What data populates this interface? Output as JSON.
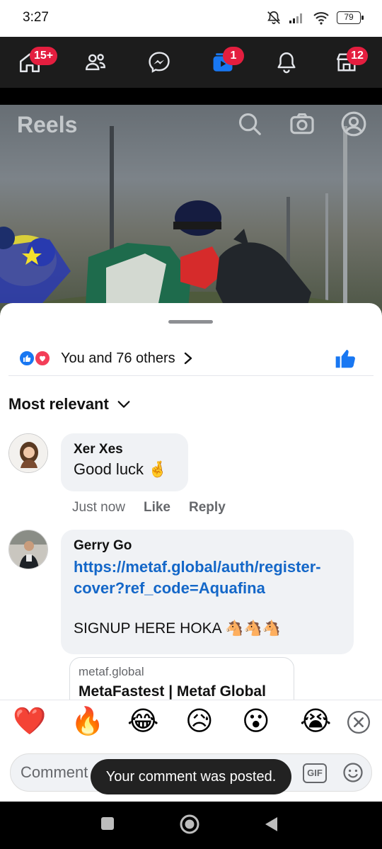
{
  "status": {
    "time": "3:27",
    "battery": "79"
  },
  "nav": {
    "home_badge": "15+",
    "watch_badge": "1",
    "marketplace_badge": "12"
  },
  "reels": {
    "title": "Reels"
  },
  "reactions": {
    "summary": "You and 76 others"
  },
  "sort": {
    "label": "Most relevant"
  },
  "comments": [
    {
      "author": "Xer Xes",
      "text": "Good luck 🤞",
      "time": "Just now",
      "like": "Like",
      "reply": "Reply"
    },
    {
      "author": "Gerry Go",
      "link": "https://metaf.global/auth/register-cover?ref_code=Aquafina",
      "link_line1": "https://metaf.global/auth/register-",
      "link_line2": "cover?ref_code=Aquafina",
      "text": "SIGNUP HERE HOKA 🐴🐴🐴",
      "preview_domain": "metaf.global",
      "preview_title": "MetaFastest | Metaf Global"
    }
  ],
  "emoji_bar": [
    "❤️",
    "🔥",
    "😂",
    "😥",
    "😮",
    "😭"
  ],
  "composer": {
    "placeholder": "Comment",
    "gif": "GIF"
  },
  "toast": "Your comment was posted.",
  "colors": {
    "fb_blue": "#1877f2",
    "badge_red": "#e41e3f",
    "link_blue": "#1467c8"
  }
}
